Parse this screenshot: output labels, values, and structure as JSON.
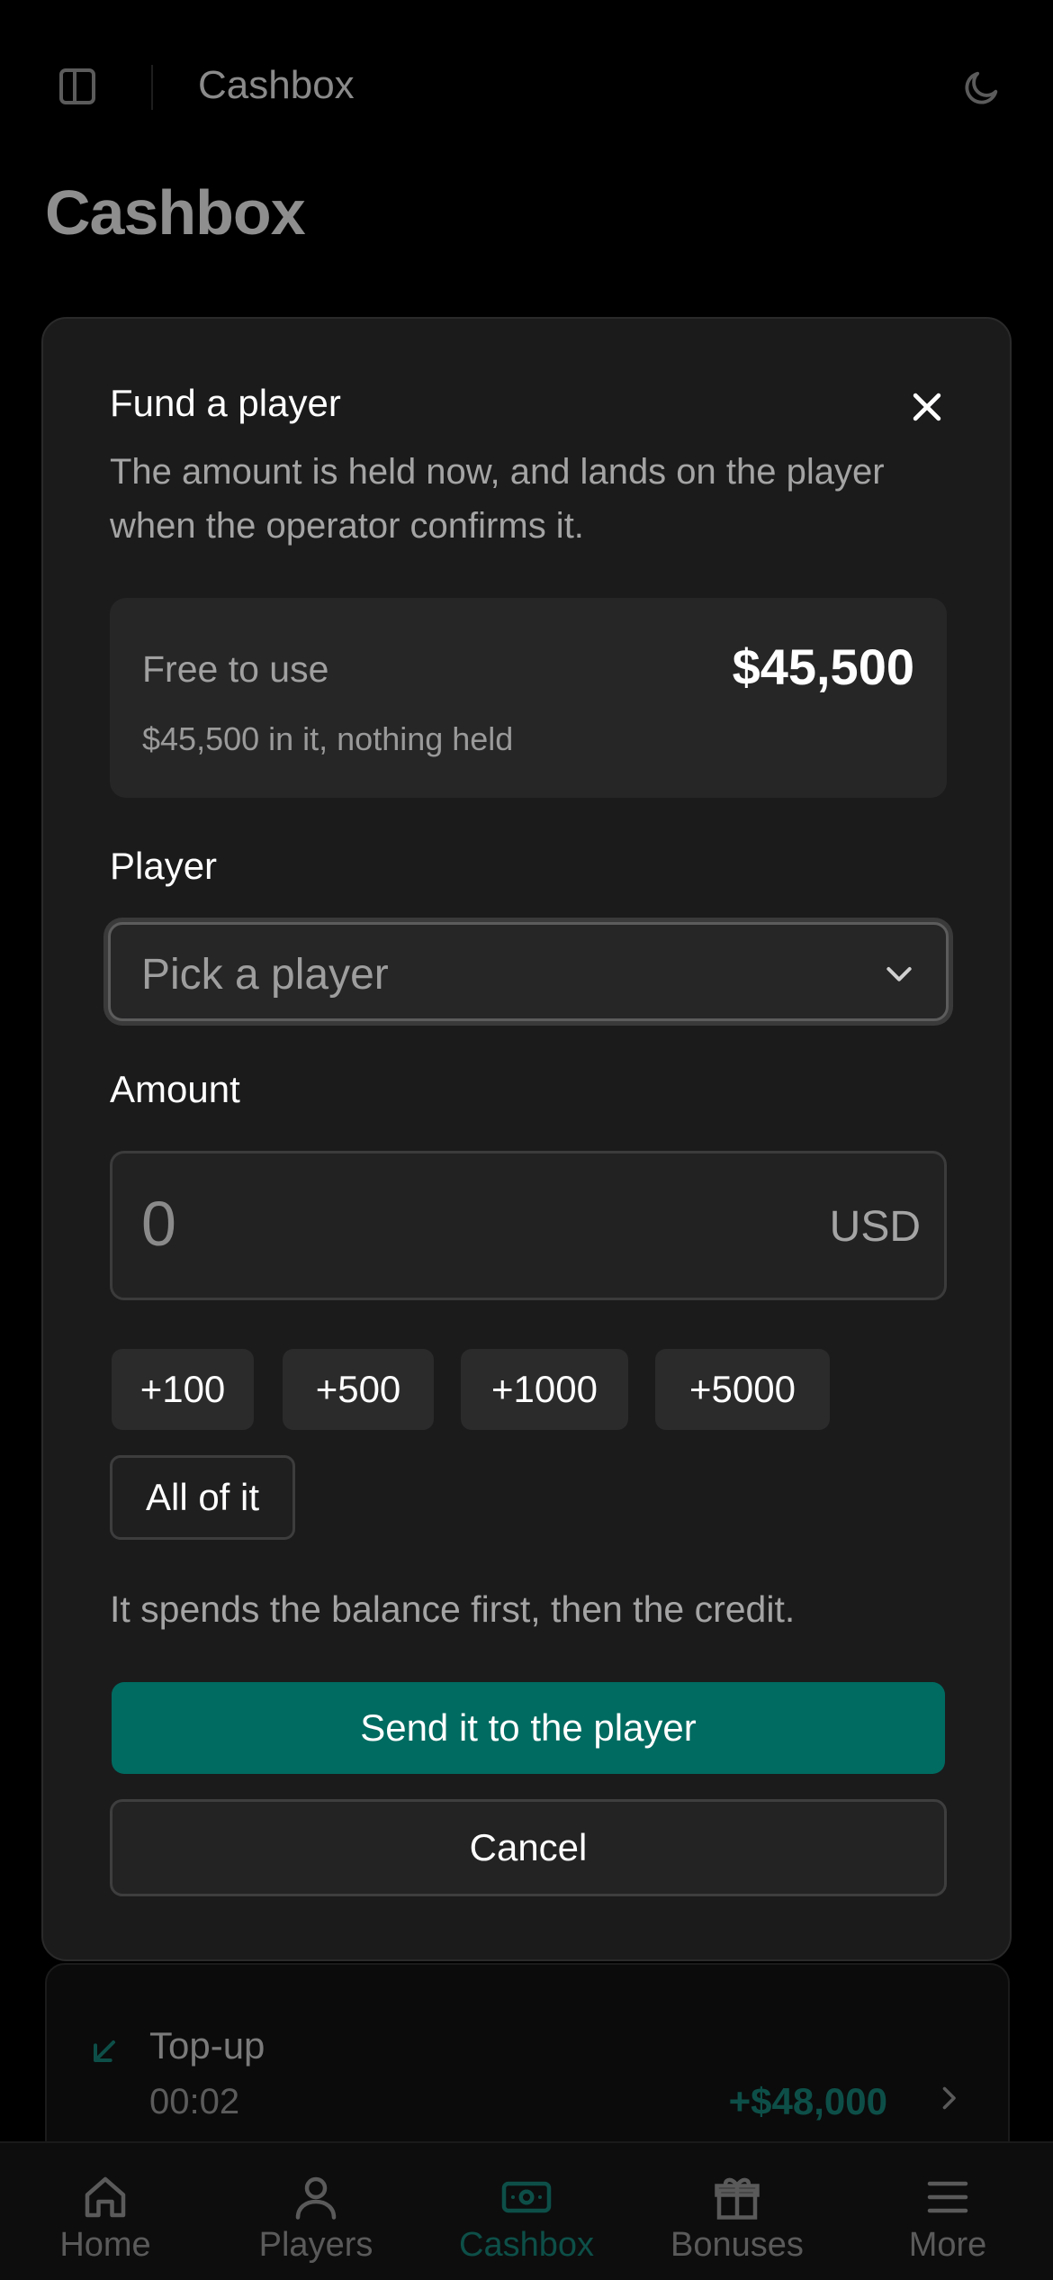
{
  "header": {
    "title": "Cashbox",
    "sidebar_icon": "sidebar-toggle-icon",
    "theme_icon": "moon-icon"
  },
  "page": {
    "title": "Cashbox"
  },
  "transaction": {
    "title": "Top-up",
    "time": "00:02",
    "amount": "+$48,000",
    "icon": "arrow-down-left-icon"
  },
  "modal": {
    "title": "Fund a player",
    "description": "The amount is held now, and lands on the player when the operator confirms it.",
    "balance": {
      "label": "Free to use",
      "value": "$45,500",
      "sub": "$45,500 in it, nothing held"
    },
    "player": {
      "label": "Player",
      "placeholder": "Pick a player"
    },
    "amount": {
      "label": "Amount",
      "value": "0",
      "currency": "USD"
    },
    "quick_amounts": [
      "+100",
      "+500",
      "+1000",
      "+5000"
    ],
    "all_label": "All of it",
    "hint": "It spends the balance first, then the credit.",
    "send_label": "Send it to the player",
    "cancel_label": "Cancel"
  },
  "nav": {
    "items": [
      {
        "label": "Home",
        "icon": "home-icon"
      },
      {
        "label": "Players",
        "icon": "user-icon"
      },
      {
        "label": "Cashbox",
        "icon": "cash-icon",
        "active": true
      },
      {
        "label": "Bonuses",
        "icon": "gift-icon"
      },
      {
        "label": "More",
        "icon": "menu-icon"
      }
    ]
  },
  "colors": {
    "accent": "#006b61",
    "modal_bg": "#1b1b1c",
    "page_bg": "#000000"
  }
}
